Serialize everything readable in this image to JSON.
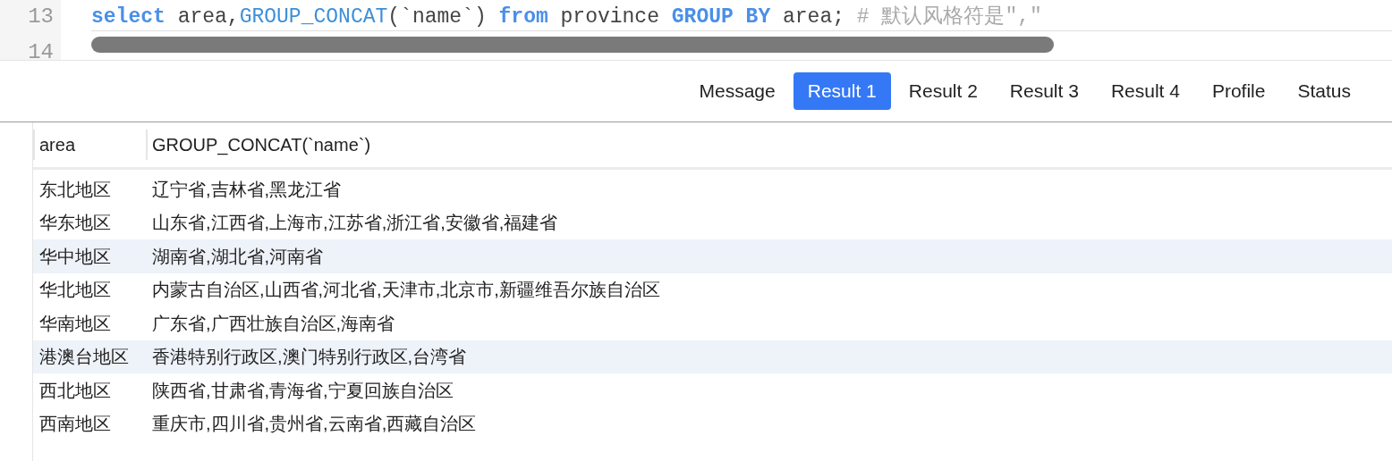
{
  "editor": {
    "lines": [
      {
        "number": "13",
        "tokens": [
          {
            "kind": "keyword",
            "text": "select"
          },
          {
            "kind": "plain",
            "text": " area,"
          },
          {
            "kind": "function",
            "text": "GROUP_CONCAT"
          },
          {
            "kind": "plain",
            "text": "(`name`) "
          },
          {
            "kind": "keyword",
            "text": "from"
          },
          {
            "kind": "plain",
            "text": " province "
          },
          {
            "kind": "keyword",
            "text": "GROUP BY"
          },
          {
            "kind": "plain",
            "text": " area; "
          },
          {
            "kind": "comment",
            "text": "# 默认风格符是\",\""
          }
        ]
      },
      {
        "number": "14"
      }
    ]
  },
  "tabs": [
    {
      "label": "Message",
      "selected": false
    },
    {
      "label": "Result 1",
      "selected": true
    },
    {
      "label": "Result 2",
      "selected": false
    },
    {
      "label": "Result 3",
      "selected": false
    },
    {
      "label": "Result 4",
      "selected": false
    },
    {
      "label": "Profile",
      "selected": false
    },
    {
      "label": "Status",
      "selected": false
    }
  ],
  "table": {
    "columns": [
      "area",
      "GROUP_CONCAT(`name`)"
    ],
    "rows": [
      {
        "cells": [
          "东北地区",
          "辽宁省,吉林省,黑龙江省"
        ],
        "highlighted": false
      },
      {
        "cells": [
          "华东地区",
          "山东省,江西省,上海市,江苏省,浙江省,安徽省,福建省"
        ],
        "highlighted": false
      },
      {
        "cells": [
          "华中地区",
          "湖南省,湖北省,河南省"
        ],
        "highlighted": true
      },
      {
        "cells": [
          "华北地区",
          "内蒙古自治区,山西省,河北省,天津市,北京市,新疆维吾尔族自治区"
        ],
        "highlighted": false
      },
      {
        "cells": [
          "华南地区",
          "广东省,广西壮族自治区,海南省"
        ],
        "highlighted": false
      },
      {
        "cells": [
          "港澳台地区",
          "香港特别行政区,澳门特别行政区,台湾省"
        ],
        "highlighted": true
      },
      {
        "cells": [
          "西北地区",
          "陕西省,甘肃省,青海省,宁夏回族自治区"
        ],
        "highlighted": false
      },
      {
        "cells": [
          "西南地区",
          "重庆市,四川省,贵州省,云南省,西藏自治区"
        ],
        "highlighted": false
      }
    ]
  }
}
